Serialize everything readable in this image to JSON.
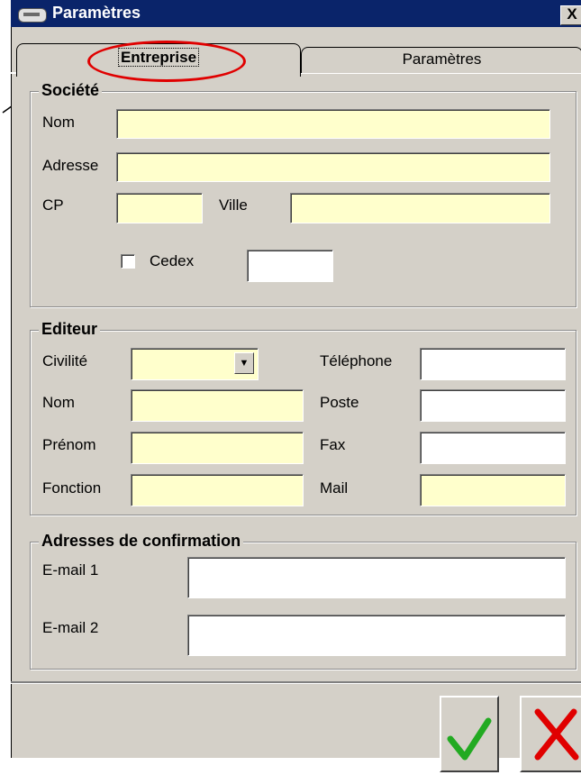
{
  "window": {
    "title": "Paramètres",
    "close_label": "X"
  },
  "tabs": [
    {
      "label": "Entreprise"
    },
    {
      "label": "Paramètres"
    }
  ],
  "societe": {
    "legend": "Société",
    "nom_label": "Nom",
    "adresse_label": "Adresse",
    "cp_label": "CP",
    "ville_label": "Ville",
    "cedex_label": "Cedex"
  },
  "editeur": {
    "legend": "Editeur",
    "civilite_label": "Civilité",
    "nom_label": "Nom",
    "prenom_label": "Prénom",
    "fonction_label": "Fonction",
    "telephone_label": "Téléphone",
    "poste_label": "Poste",
    "fax_label": "Fax",
    "mail_label": "Mail",
    "dropdown_arrow": "▼"
  },
  "confirmation": {
    "legend": "Adresses de confirmation",
    "email1_label": "E-mail 1",
    "email2_label": "E-mail 2"
  },
  "colors": {
    "required_field": "#ffffcc",
    "annotation_oval": "#e00000",
    "ok_check": "#22aa22",
    "cancel_x": "#e00000"
  }
}
